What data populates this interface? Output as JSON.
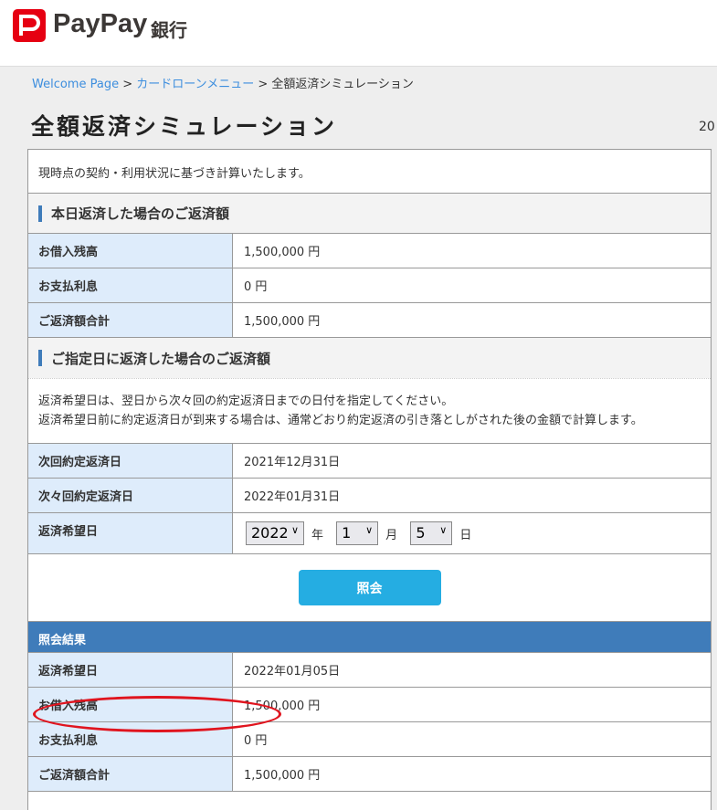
{
  "brand": {
    "name": "PayPay",
    "sub": "銀行"
  },
  "breadcrumb": {
    "home": "Welcome Page",
    "sep": ">",
    "menu": "カードローンメニュー",
    "current": "全額返済シミュレーション"
  },
  "title": "全額返済シミュレーション",
  "edge_text": "20",
  "intro": "現時点の契約・利用状況に基づき計算いたします。",
  "today": {
    "heading": "本日返済した場合のご返済額",
    "rows": [
      {
        "label": "お借入残高",
        "value": "1,500,000 円"
      },
      {
        "label": "お支払利息",
        "value": "0 円"
      },
      {
        "label": "ご返済額合計",
        "value": "1,500,000 円"
      }
    ]
  },
  "specified": {
    "heading": "ご指定日に返済した場合のご返済額",
    "note1": "返済希望日は、翌日から次々回の約定返済日までの日付を指定してください。",
    "note2": "返済希望日前に約定返済日が到来する場合は、通常どおり約定返済の引き落としがされた後の金額で計算します。",
    "rows": [
      {
        "label": "次回約定返済日",
        "value": "2021年12月31日"
      },
      {
        "label": "次々回約定返済日",
        "value": "2022年01月31日"
      }
    ],
    "desired_label": "返済希望日",
    "year": "2022",
    "year_unit": "年",
    "month": "1",
    "month_unit": "月",
    "day": "5",
    "day_unit": "日"
  },
  "button": "照会",
  "result": {
    "heading": "照会結果",
    "rows": [
      {
        "label": "返済希望日",
        "value": "2022年01月05日"
      },
      {
        "label": "お借入残高",
        "value": "1,500,000 円"
      },
      {
        "label": "お支払利息",
        "value": "0 円"
      },
      {
        "label": "ご返済額合計",
        "value": "1,500,000 円"
      }
    ]
  }
}
